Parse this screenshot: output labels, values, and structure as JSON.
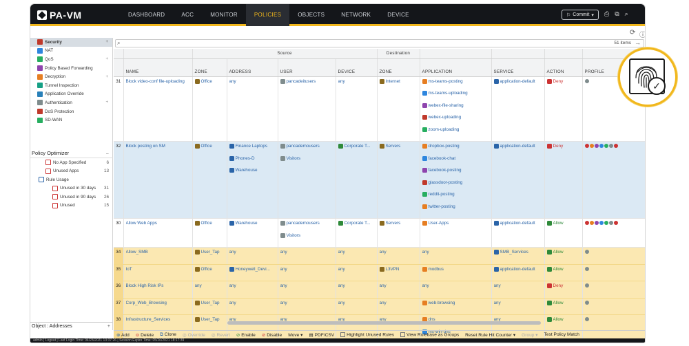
{
  "app": {
    "name": "PA-VM"
  },
  "nav": {
    "tabs": [
      "DASHBOARD",
      "ACC",
      "MONITOR",
      "POLICIES",
      "OBJECTS",
      "NETWORK",
      "DEVICE"
    ],
    "active": "POLICIES"
  },
  "header": {
    "commit_label": "Commit"
  },
  "sidebar": {
    "items": [
      {
        "label": "Security",
        "active": true,
        "color": "#c0392b"
      },
      {
        "label": "NAT",
        "color": "#2e86de"
      },
      {
        "label": "QoS",
        "color": "#27ae60"
      },
      {
        "label": "Policy Based Forwarding",
        "color": "#8e44ad"
      },
      {
        "label": "Decryption",
        "color": "#e67e22"
      },
      {
        "label": "Tunnel Inspection",
        "color": "#16a085"
      },
      {
        "label": "Application Override",
        "color": "#2980b9"
      },
      {
        "label": "Authentication",
        "color": "#7f8c8d"
      },
      {
        "label": "DoS Protection",
        "color": "#c0392b"
      },
      {
        "label": "SD-WAN",
        "color": "#27ae60"
      }
    ]
  },
  "optimizer": {
    "title": "Policy Optimizer",
    "items": [
      {
        "label": "No App Specified",
        "count": "6",
        "indent": 1
      },
      {
        "label": "Unused Apps",
        "count": "13",
        "indent": 1
      },
      {
        "label": "Rule Usage",
        "count": "",
        "indent": 0
      },
      {
        "label": "Unused in 30 days",
        "count": "31",
        "indent": 2
      },
      {
        "label": "Unused in 90 days",
        "count": "26",
        "indent": 2
      },
      {
        "label": "Unused",
        "count": "15",
        "indent": 2
      }
    ]
  },
  "sidebar_footer": {
    "label": "Object : Addresses"
  },
  "search": {
    "items_label": "51 items"
  },
  "table": {
    "group_headers": {
      "source": "Source",
      "destination": "Destination"
    },
    "columns": [
      "NAME",
      "ZONE",
      "ADDRESS",
      "USER",
      "DEVICE",
      "ZONE",
      "APPLICATION",
      "SERVICE",
      "ACTION",
      "PROFILE"
    ],
    "rows": [
      {
        "num": "31",
        "name": "Block video-conf file-uploading",
        "src_zone": "Office",
        "address": [
          "any"
        ],
        "user": [
          "pancadeitusers"
        ],
        "device": "any",
        "dst_zone": "Internet",
        "apps": [
          "ms-teams-posting",
          "ms-teams-uploading",
          "webex-file-sharing",
          "webex-uploading",
          "zoom-uploading"
        ],
        "service": "application-default",
        "action": "Deny"
      },
      {
        "num": "32",
        "name": "Block posting on SM",
        "src_zone": "Office",
        "address": [
          "Finance Laptops",
          "Phones-D",
          "Warehouse"
        ],
        "user": [
          "pancademousers",
          "Visitors"
        ],
        "device": "Corporate T...",
        "dst_zone": "Servers",
        "apps": [
          "dropbox-posting",
          "facebook-chat",
          "facebook-posting",
          "glassdoor-posting",
          "reddit-posting",
          "twitter-posting"
        ],
        "service": "application-default",
        "action": "Deny"
      },
      {
        "num": "30",
        "name": "Allow Web Apps",
        "src_zone": "Office",
        "address": [
          "Warehouse"
        ],
        "user": [
          "pancademousers",
          "Visitors"
        ],
        "device": "Corporate T...",
        "dst_zone": "Servers",
        "apps": [
          "User-Apps"
        ],
        "service": "application-default",
        "action": "Allow"
      },
      {
        "num": "34",
        "name": "Allow_SMB",
        "src_zone": "User_Tap",
        "address": [
          "any"
        ],
        "user": [
          "any"
        ],
        "device": "any",
        "dst_zone": "any",
        "apps": [
          "any"
        ],
        "service": "SMB_Services",
        "action": "Allow"
      },
      {
        "num": "35",
        "name": "IoT",
        "src_zone": "Office",
        "address": [
          "Honeywell_Devi..."
        ],
        "user": [
          "any"
        ],
        "device": "any",
        "dst_zone": "L3VPN",
        "apps": [
          "modbus"
        ],
        "service": "application-default",
        "action": "Allow"
      },
      {
        "num": "36",
        "name": "Block High Risk IPs",
        "src_zone": "any",
        "address": [
          "any"
        ],
        "user": [
          "any"
        ],
        "device": "any",
        "dst_zone": "any",
        "apps": [
          "any"
        ],
        "service": "any",
        "action": "Deny"
      },
      {
        "num": "37",
        "name": "Corp_Web_Browsing",
        "src_zone": "User_Tap",
        "address": [
          "any"
        ],
        "user": [
          "any"
        ],
        "device": "any",
        "dst_zone": "any",
        "apps": [
          "web-browsing"
        ],
        "service": "any",
        "action": "Allow"
      },
      {
        "num": "38",
        "name": "Infrastructure_Services",
        "src_zone": "User_Tap",
        "address": [
          "any"
        ],
        "user": [
          "any"
        ],
        "device": "any",
        "dst_zone": "any",
        "apps": [
          "dns",
          "ms-win-dns"
        ],
        "service": "any",
        "action": "Allow"
      }
    ]
  },
  "toolbar": {
    "add": "Add",
    "delete": "Delete",
    "clone": "Clone",
    "override": "Override",
    "revert": "Revert",
    "enable": "Enable",
    "disable": "Disable",
    "move": "Move",
    "pdf": "PDF/CSV",
    "highlight": "Highlight Unused Rules",
    "view_groups": "View Rulebase as Groups",
    "reset": "Reset Rule Hit Counter",
    "group": "Group",
    "test": "Test Policy Match"
  },
  "status_bar": {
    "text": "admin | Logout | Last Login Time: 04/23/2021 13:37:26 | Session Expire Time: 05/26/2021 18:17:39"
  },
  "colors": {
    "accent": "#f1b71c",
    "topbar": "#14161a",
    "row_selected": "#dbe9f4",
    "row_highlight": "#fbe8b2"
  }
}
